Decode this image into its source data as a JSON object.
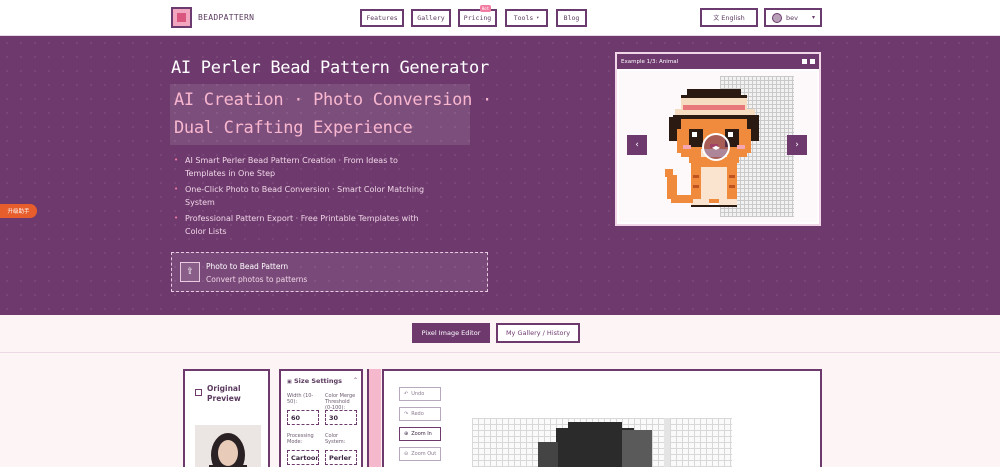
{
  "header": {
    "brand": "BEADPATTERN",
    "nav": [
      {
        "label": "Features"
      },
      {
        "label": "Gallery"
      },
      {
        "label": "Pricing",
        "badge": "Hot"
      },
      {
        "label": "Tools"
      },
      {
        "label": "Blog"
      }
    ],
    "language": "English",
    "user": "bev"
  },
  "hero": {
    "title": "AI Perler Bead Pattern Generator",
    "subtitle_line1": "AI Creation  ·  Photo Conversion  ·",
    "subtitle_line2": "Dual Crafting Experience",
    "bullets": [
      {
        "line1": "AI Smart Perler Bead Pattern Creation · From Ideas to",
        "line2": "Templates in One Step"
      },
      {
        "line1": "One-Click Photo to Bead Conversion · Smart Color Matching",
        "line2": "System"
      },
      {
        "line1": "Professional Pattern Export · Free Printable Templates with",
        "line2": "Color Lists"
      }
    ],
    "upload": {
      "title": "Photo to Bead Pattern",
      "desc": "Convert photos to patterns"
    }
  },
  "assistant": "升级助手",
  "example": {
    "caption": "Example 1/3: Animal"
  },
  "tabs": [
    {
      "label": "Pixel Image Editor",
      "active": true
    },
    {
      "label": "My Gallery / History",
      "active": false
    }
  ],
  "editor": {
    "original_title": "Original Preview",
    "size_title": "Size Settings",
    "width_label": "Width (10-50):",
    "width_value": "60",
    "merge_label": "Color Merge Threshold (0-100):",
    "merge_value": "30",
    "mode_label": "Processing Mode:",
    "mode_value": "Cartoon",
    "color_label": "Color System:",
    "color_value": "Perler",
    "tools": {
      "undo": "Undo",
      "redo": "Redo",
      "zoom_in": "Zoom In",
      "zoom_out": "Zoom Out"
    }
  },
  "colors": {
    "primary": "#6e3a6e",
    "accent": "#f27ca2",
    "highlight": "#f9b7cf"
  }
}
